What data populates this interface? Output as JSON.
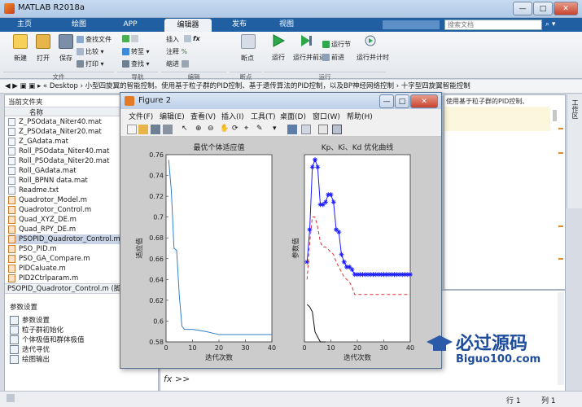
{
  "window": {
    "title": "MATLAB R2018a",
    "buttons": {
      "min": "—",
      "max": "□",
      "close": "✕"
    }
  },
  "tabs": [
    {
      "label": "主页"
    },
    {
      "label": "绘图"
    },
    {
      "label": "APP"
    },
    {
      "label": "编辑器"
    },
    {
      "label": "发布"
    },
    {
      "label": "视图"
    }
  ],
  "search": {
    "placeholder": "搜索文档"
  },
  "ribbon": {
    "file": {
      "new": "新建",
      "open": "打开",
      "save": "保存",
      "find_files": "查找文件",
      "compare": "比较",
      "print": "打印",
      "group": "文件"
    },
    "nav": {
      "goto": "转至",
      "find": "查找",
      "group": "导航"
    },
    "edit": {
      "insert": "插入",
      "fx": "fx",
      "comment": "注释",
      "indent": "缩进",
      "group": "编辑"
    },
    "breakpoints": {
      "label": "断点",
      "group": "断点"
    },
    "run": {
      "run": "运行",
      "run_advance": "运行并前进",
      "run_section": "运行节",
      "advance": "前进",
      "run_time": "运行并计时",
      "group": "运行"
    }
  },
  "addressbar": {
    "path": "« Desktop › 小型四旋翼的智能控制。使用基于粒子群的PID控制、基于遗传算法的PID控制，以及BP神经网络控制 › 十字型四旋翼智能控制"
  },
  "left": {
    "header": "当前文件夹",
    "column": "名称",
    "files": [
      {
        "name": "Z_PSOdata_Niter40.mat",
        "type": "mat"
      },
      {
        "name": "Z_PSOdata_Niter20.mat",
        "type": "mat"
      },
      {
        "name": "Z_GAdata.mat",
        "type": "mat"
      },
      {
        "name": "Roll_PSOdata_Niter40.mat",
        "type": "mat"
      },
      {
        "name": "Roll_PSOdata_Niter20.mat",
        "type": "mat"
      },
      {
        "name": "Roll_GAdata.mat",
        "type": "mat"
      },
      {
        "name": "Roll_BPNN data.mat",
        "type": "mat"
      },
      {
        "name": "Readme.txt",
        "type": "txt"
      },
      {
        "name": "Quadrotor_Model.m",
        "type": "m"
      },
      {
        "name": "Quadrotor_Control.m",
        "type": "m"
      },
      {
        "name": "Quad_XYZ_DE.m",
        "type": "m"
      },
      {
        "name": "Quad_RPY_DE.m",
        "type": "m"
      },
      {
        "name": "PSOPID_Quadrotor_Control.m",
        "type": "m",
        "selected": true
      },
      {
        "name": "PSO_PID.m",
        "type": "m"
      },
      {
        "name": "PSO_GA_Compare.m",
        "type": "m"
      },
      {
        "name": "PIDCaluate.m",
        "type": "m"
      },
      {
        "name": "PID2Ctrlparam.m",
        "type": "m"
      }
    ],
    "details_title": "PSOPID_Quadrotor_Control.m (脚",
    "sections_header": "参数设置",
    "sections": [
      "参数设置",
      "粒子群初始化",
      "个体极值和群体极值",
      "迭代寻优",
      "绘图输出"
    ]
  },
  "editor": {
    "snippet": "使用基于粒子群的PID控制、"
  },
  "workspace_tab": "工作区",
  "command": {
    "prompt": "fx >>"
  },
  "status": {
    "row_label": "行",
    "row": "1",
    "col_label": "列",
    "col": "1"
  },
  "figure": {
    "title": "Figure 2",
    "menu": [
      "文件(F)",
      "编辑(E)",
      "查看(V)",
      "插入(I)",
      "工具(T)",
      "桌面(D)",
      "窗口(W)",
      "帮助(H)"
    ]
  },
  "watermark": {
    "text": "必过源码",
    "url": "Biguo100.com"
  },
  "chart_data": [
    {
      "type": "line",
      "title": "最优个体适应值",
      "xlabel": "迭代次数",
      "ylabel": "适应值",
      "xlim": [
        0,
        40
      ],
      "ylim": [
        0.58,
        0.76
      ],
      "xticks": [
        "0",
        "10",
        "20",
        "30",
        "40"
      ],
      "yticks": [
        "0.58",
        "0.6",
        "0.62",
        "0.64",
        "0.66",
        "0.68",
        "0.7",
        "0.72",
        "0.74",
        "0.76"
      ],
      "series": [
        {
          "color": "#2f7fc9",
          "x": [
            1,
            2,
            3,
            4,
            5,
            6,
            7,
            10,
            15,
            20,
            25,
            30,
            35,
            40
          ],
          "y": [
            0.755,
            0.725,
            0.67,
            0.668,
            0.625,
            0.595,
            0.592,
            0.592,
            0.59,
            0.587,
            0.587,
            0.587,
            0.587,
            0.587
          ]
        }
      ]
    },
    {
      "type": "line",
      "title": "Kp、Ki、Kd 优化曲线",
      "xlabel": "迭代次数",
      "ylabel": "参数值",
      "xlim": [
        0,
        40
      ],
      "xticks": [
        "0",
        "10",
        "20",
        "30",
        "40"
      ],
      "series": [
        {
          "color": "#1a1aff",
          "marker": "star",
          "x": [
            1,
            2,
            3,
            4,
            5,
            6,
            7,
            8,
            9,
            10,
            11,
            12,
            13,
            14,
            15,
            16,
            17,
            18,
            19,
            20,
            21,
            22,
            23,
            24,
            25,
            26,
            27,
            28,
            29,
            30,
            31,
            32,
            33,
            34,
            35,
            36,
            37,
            38,
            39,
            40
          ],
          "y": [
            32,
            45,
            70,
            73,
            70,
            55,
            55,
            56,
            59,
            59,
            56,
            45,
            44,
            35,
            32,
            30,
            30,
            29,
            27,
            27,
            27,
            27,
            27,
            27,
            27,
            27,
            27,
            27,
            27,
            27,
            27,
            27,
            27,
            27,
            27,
            27,
            27,
            27,
            27,
            27
          ]
        },
        {
          "color": "#e03030",
          "dash": true,
          "x": [
            1,
            2,
            3,
            4,
            5,
            6,
            7,
            8,
            9,
            10,
            11,
            12,
            13,
            14,
            15,
            16,
            17,
            18,
            19,
            20,
            25,
            30,
            35,
            40
          ],
          "y": [
            25,
            40,
            50,
            50,
            46,
            40,
            38,
            38,
            37,
            36,
            35,
            32,
            30,
            28,
            26,
            25,
            24,
            22,
            19,
            19,
            19,
            19,
            19,
            19
          ]
        },
        {
          "color": "#111111",
          "x": [
            1,
            2,
            3,
            4,
            5,
            6,
            7,
            8
          ],
          "y": [
            15,
            14,
            12,
            4,
            2,
            0,
            0,
            0
          ]
        }
      ]
    }
  ]
}
